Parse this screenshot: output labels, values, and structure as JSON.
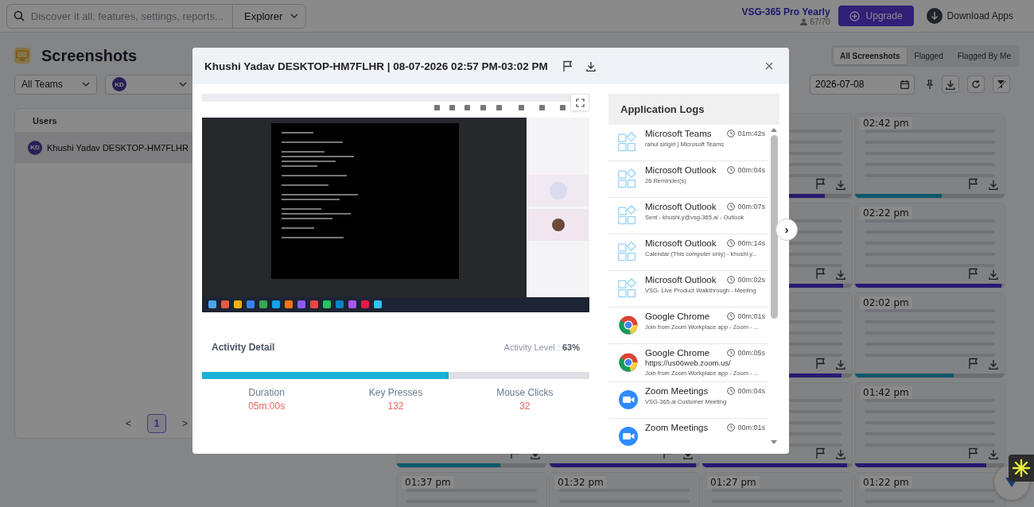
{
  "top_bar": {
    "search": {
      "placeholder": "Discover it all: features, settings, reports..."
    },
    "explorer": "Explorer",
    "plan": {
      "name": "VSG-365 Pro Yearly",
      "seats": "67/70"
    },
    "upgrade": "Upgrade",
    "download_apps": "Download Apps"
  },
  "page": {
    "title": "Screenshots",
    "view_tabs": [
      {
        "label": "All Screenshots",
        "selected": true
      },
      {
        "label": "Flagged",
        "selected": false
      },
      {
        "label": "Flagged By Me",
        "selected": false
      }
    ]
  },
  "filters": {
    "team": "All Teams",
    "user_avatar": "KD",
    "date": "2026-07-08"
  },
  "users": {
    "header": "Users",
    "rows": [
      {
        "avatar": "KD",
        "name": "Khushi Yadav DESKTOP-HM7FLHR",
        "selected": true
      }
    ],
    "prev": "<",
    "next": ">",
    "pages": [
      {
        "label": "1",
        "selected": true
      }
    ]
  },
  "thumbnail_rows": [
    [
      {
        "kind": "primary",
        "level": 0.82
      },
      {
        "time": "02:42 pm",
        "kind": "secondary",
        "level": 0.58
      }
    ],
    [
      {
        "kind": "primary",
        "level": 0.94
      },
      {
        "time": "02:22 pm",
        "kind": "primary",
        "level": 0.98
      }
    ],
    [
      {
        "kind": "primary",
        "level": 0.93
      },
      {
        "time": "02:02 pm",
        "kind": "secondary",
        "level": 0.66
      }
    ],
    [
      {
        "kind": "secondary",
        "level": 0.69
      },
      {
        "kind": "primary",
        "level": 0.98
      },
      {
        "kind": "primary",
        "level": 0.97
      },
      {
        "time": "01:42 pm",
        "kind": "primary",
        "level": 0.88
      }
    ],
    [
      {
        "time": "01:37 pm"
      },
      {
        "time": "01:32 pm"
      },
      {
        "time": "01:27 pm"
      },
      {
        "time": "01:22 pm"
      }
    ]
  ],
  "modal": {
    "title": "Khushi Yadav DESKTOP-HM7FLHR | 08-07-2026 02:57 PM-03:02 PM",
    "activity": {
      "title": "Activity Detail",
      "level_label": "Activity Level : ",
      "level_value": "63%",
      "level": 0.636,
      "stats": [
        {
          "label": "Duration",
          "value": "05m:00s"
        },
        {
          "label": "Key Presses",
          "value": "132"
        },
        {
          "label": "Mouse Clicks",
          "value": "32"
        }
      ]
    },
    "logs": {
      "title": "Application Logs",
      "items": [
        {
          "kind": "app",
          "name": "Microsoft Teams",
          "time": "01m:42s",
          "lines": [
            "rahul sirigiri | Microsoft Teams"
          ]
        },
        {
          "kind": "app",
          "name": "Microsoft Outlook",
          "time": "00m:04s",
          "lines": [
            "26 Reminder(s)"
          ]
        },
        {
          "kind": "app",
          "name": "Microsoft Outlook",
          "time": "00m:07s",
          "lines": [
            "Sent - khushi.y@vsg-365.ai - Outlook"
          ]
        },
        {
          "kind": "app",
          "name": "Microsoft Outlook",
          "time": "00m:14s",
          "lines": [
            "Calendar (This computer only) - khushi.y..."
          ]
        },
        {
          "kind": "app",
          "name": "Microsoft Outlook",
          "time": "00m:02s",
          "lines": [
            "VSG- Live Product Walkthrough - Meeting"
          ]
        },
        {
          "kind": "chrome",
          "name": "Google Chrome",
          "time": "00m:01s",
          "lines": [
            "Join from Zoom Workplace app - Zoom - ..."
          ]
        },
        {
          "kind": "chrome",
          "name": "Google Chrome",
          "time": "00m:05s",
          "url": "https://us06web.zoom.us/",
          "lines": [
            "Join from Zoom Workplace app - Zoom - ..."
          ]
        },
        {
          "kind": "zoom",
          "name": "Zoom Meetings",
          "time": "00m:04s",
          "lines": [
            "VSG-365.ai Customer Meeting"
          ]
        },
        {
          "kind": "zoom",
          "name": "Zoom Meetings",
          "time": "00m:01s"
        }
      ]
    },
    "next": "›"
  }
}
